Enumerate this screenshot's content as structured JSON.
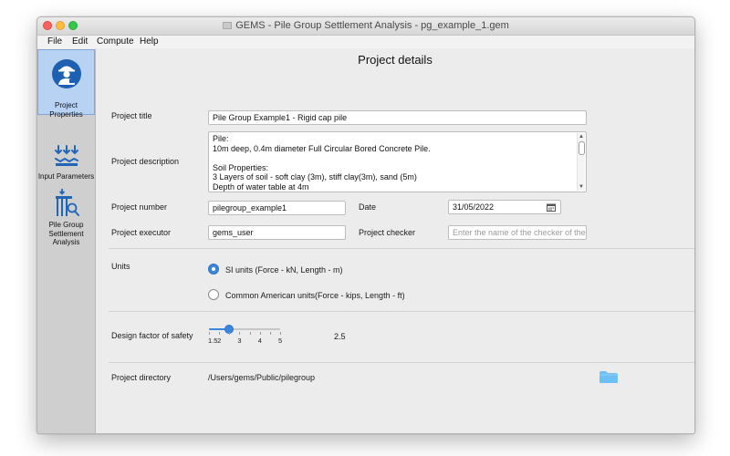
{
  "window": {
    "title": "GEMS - Pile Group Settlement Analysis - pg_example_1.gem"
  },
  "menubar": {
    "items": [
      "File",
      "Edit",
      "Compute",
      "Help"
    ]
  },
  "sidebar": {
    "items": [
      {
        "label": "Project Properties",
        "icon": "engineer-icon",
        "active": true
      },
      {
        "label": "Input Parameters",
        "icon": "load-arrows-icon",
        "active": false
      },
      {
        "label": "Pile Group Settlement Analysis",
        "label_lines": [
          "Pile Group",
          "Settlement",
          "Analysis"
        ],
        "icon": "pile-analysis-icon",
        "active": false
      }
    ]
  },
  "page": {
    "heading": "Project details",
    "project_title": {
      "label": "Project title",
      "value": "Pile Group Example1 - Rigid cap pile"
    },
    "project_description": {
      "label": "Project description",
      "lines": [
        "Pile:",
        "10m deep, 0.4m diameter Full Circular Bored Concrete Pile.",
        "",
        "Soil Properties:",
        "3 Layers of soil - soft clay (3m), stiff clay(3m), sand (5m)",
        "Depth of water table at 4m"
      ]
    },
    "project_number": {
      "label": "Project number",
      "value": "pilegroup_example1"
    },
    "date": {
      "label": "Date",
      "value": "31/05/2022"
    },
    "project_executor": {
      "label": "Project executor",
      "value": "gems_user"
    },
    "project_checker": {
      "label": "Project checker",
      "value": "",
      "placeholder": "Enter the name of the checker of the p"
    },
    "units": {
      "label": "Units",
      "options": [
        {
          "label": "SI units (Force - kN, Length - m)",
          "selected": true
        },
        {
          "label": "Common American units(Force - kips, Length - ft)",
          "selected": false
        }
      ]
    },
    "safety_factor": {
      "label": "Design factor of safety",
      "value": 2.5,
      "value_text": "2.5",
      "min": 1.5,
      "max": 5,
      "tick_labels": [
        "1.5",
        "2",
        "3",
        "4",
        "5"
      ]
    },
    "project_directory": {
      "label": "Project directory",
      "value": "/Users/gems/Public/pilegroup"
    }
  },
  "colors": {
    "accent": "#3a86dd",
    "sidebar_active": "#b7d2f2",
    "folder": "#6cc0f5"
  }
}
